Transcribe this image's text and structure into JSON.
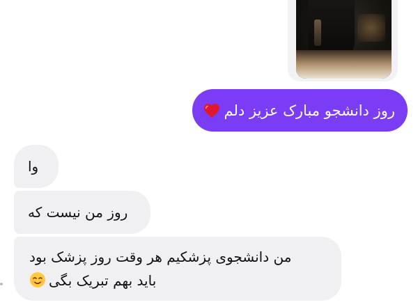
{
  "thread": {
    "outgoing_message": "روز دانشجو مبارک عزیز دلم",
    "incoming_messages": [
      {
        "text": "وا"
      },
      {
        "text": "روز من نیست که"
      },
      {
        "line1": "من دانشجوی پزشکیم هر وقت روز پزشک بود",
        "line2": "باید بهم تبریک بگی"
      }
    ]
  },
  "icons": {
    "heart": "red-heart",
    "emoji": "smiling-blush-face"
  },
  "colors": {
    "outgoing_bubble": "#7a3cf5",
    "incoming_bubble": "#f0f0f2",
    "heart": "#e0182b"
  }
}
